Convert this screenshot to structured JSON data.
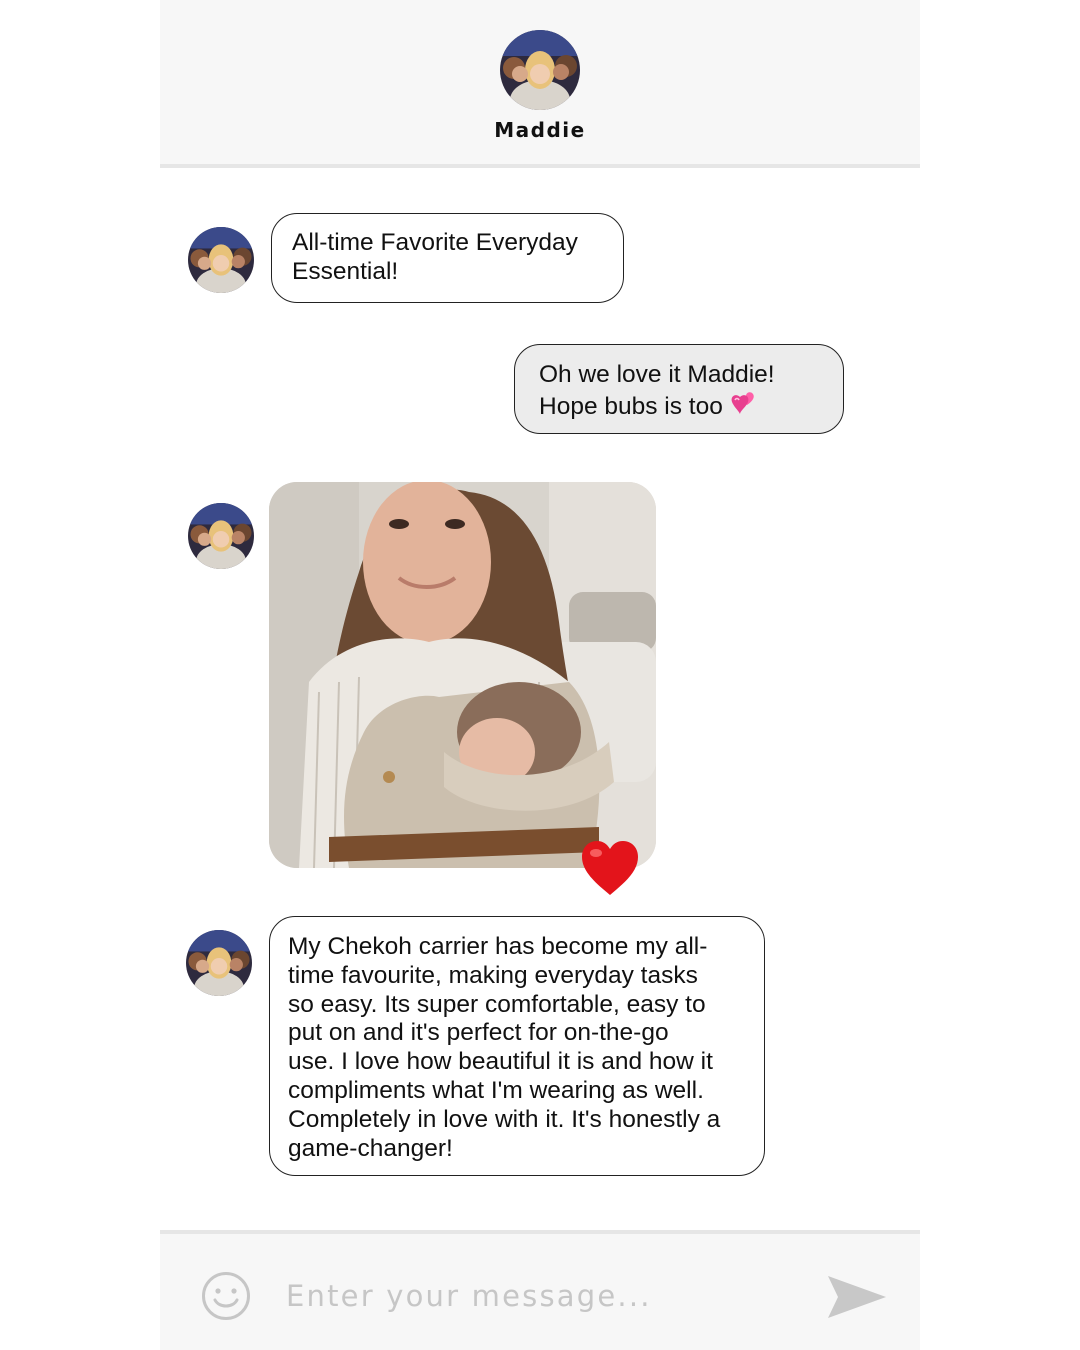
{
  "header": {
    "contact_name": "Maddie",
    "avatar_icon": "contact-avatar"
  },
  "messages": [
    {
      "direction": "incoming",
      "text": "All-time Favorite Everyday\nEssential!"
    },
    {
      "direction": "outgoing",
      "text_line1": "Oh we love it Maddie!",
      "text_line2": "Hope bubs is too",
      "emoji": "two-hearts-emoji"
    },
    {
      "direction": "incoming",
      "type": "photo",
      "reaction": "red-heart-emoji"
    },
    {
      "direction": "incoming",
      "text": "My Chekoh carrier has become my all-\ntime favourite, making everyday tasks\nso easy. Its super comfortable, easy to\nput on and it's perfect for on-the-go\nuse. I love how beautiful it is and how it\ncompliments what I'm wearing as well.\nCompletely in love with it. It's honestly a\ngame-changer!"
    }
  ],
  "composer": {
    "placeholder": "Enter your message...",
    "emoji_icon": "smiley-icon",
    "send_icon": "send-icon"
  },
  "colors": {
    "header_bg": "#f7f7f7",
    "outgoing_bubble": "#ececec",
    "bubble_border": "#222222",
    "placeholder": "#c6c6c6",
    "send_icon": "#c8c8c8",
    "heart": "#e3141b"
  }
}
